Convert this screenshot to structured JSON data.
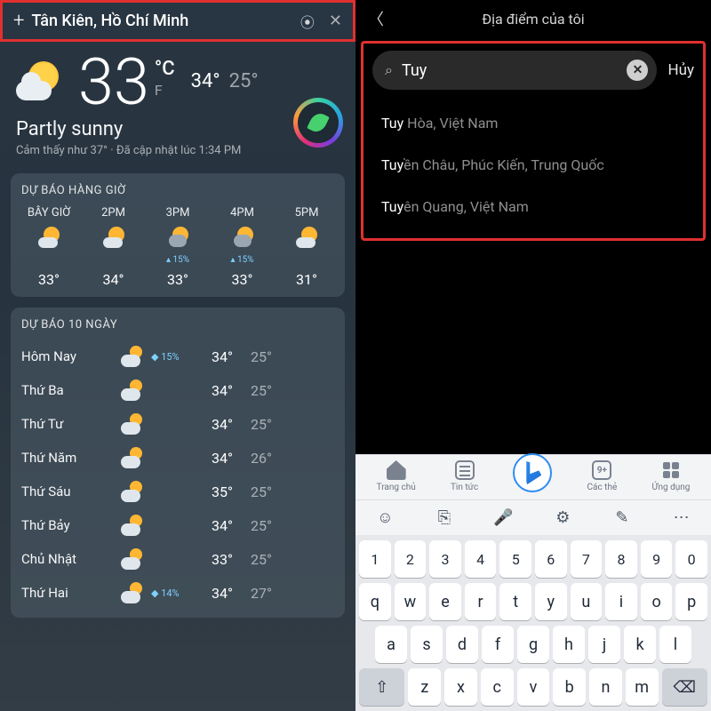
{
  "left": {
    "location": "Tân Kiên, Hồ Chí Minh",
    "temp": "33",
    "unit_c": "°C",
    "unit_f": "F",
    "hi": "34°",
    "lo": "25°",
    "condition": "Partly sunny",
    "feels": "Cảm thấy như 37°",
    "updated": "Đã cập nhật lúc 1:34 PM",
    "hourly_title": "DỰ BÁO HÀNG GIỜ",
    "hourly": [
      {
        "label": "BÂY GIỜ",
        "precip": "",
        "temp": "33°"
      },
      {
        "label": "2PM",
        "precip": "",
        "temp": "34°"
      },
      {
        "label": "3PM",
        "precip": "▴ 15%",
        "temp": "33°"
      },
      {
        "label": "4PM",
        "precip": "▴ 15%",
        "temp": "33°"
      },
      {
        "label": "5PM",
        "precip": "",
        "temp": "31°"
      }
    ],
    "daily_title": "DỰ BÁO 10 NGÀY",
    "daily": [
      {
        "name": "Hôm Nay",
        "precip": "◆ 15%",
        "hi": "34°",
        "lo": "25°"
      },
      {
        "name": "Thứ Ba",
        "precip": "",
        "hi": "34°",
        "lo": "25°"
      },
      {
        "name": "Thứ Tư",
        "precip": "",
        "hi": "34°",
        "lo": "25°"
      },
      {
        "name": "Thứ Năm",
        "precip": "",
        "hi": "34°",
        "lo": "26°"
      },
      {
        "name": "Thứ Sáu",
        "precip": "",
        "hi": "35°",
        "lo": "25°"
      },
      {
        "name": "Thứ Bảy",
        "precip": "",
        "hi": "34°",
        "lo": "25°"
      },
      {
        "name": "Chủ Nhật",
        "precip": "",
        "hi": "33°",
        "lo": "25°"
      },
      {
        "name": "Thứ Hai",
        "precip": "◆ 14%",
        "hi": "34°",
        "lo": "27°"
      }
    ]
  },
  "right": {
    "title": "Địa điểm của tôi",
    "search_value": "Tuy",
    "cancel": "Hủy",
    "suggestions": [
      {
        "match": "Tuy",
        "rest": " Hòa, Việt Nam"
      },
      {
        "match": "Tuy",
        "rest": "ền Châu, Phúc Kiến, Trung Quốc"
      },
      {
        "match": "Tuy",
        "rest": "ên Quang, Việt Nam"
      }
    ],
    "nav": {
      "home": "Trang chủ",
      "news": "Tin tức",
      "tabs_count": "9+",
      "tabs": "Các thẻ",
      "apps": "Ứng dụng"
    },
    "kb_tool": {
      "emoji": "☺",
      "clip": "⎘",
      "mic": "🎤",
      "gear": "⚙",
      "pen": "✎",
      "more": "⋯"
    },
    "keys": {
      "nums": [
        "1",
        "2",
        "3",
        "4",
        "5",
        "6",
        "7",
        "8",
        "9",
        "0"
      ],
      "r2": [
        "q",
        "w",
        "e",
        "r",
        "t",
        "y",
        "u",
        "i",
        "o",
        "p"
      ],
      "r3": [
        "a",
        "s",
        "d",
        "f",
        "g",
        "h",
        "j",
        "k",
        "l"
      ],
      "r4": [
        "⇧",
        "z",
        "x",
        "c",
        "v",
        "b",
        "n",
        "m",
        "⌫"
      ]
    }
  }
}
